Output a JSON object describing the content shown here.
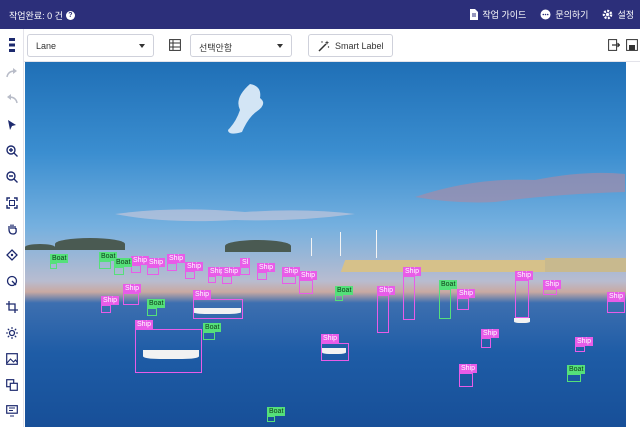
{
  "header": {
    "status_label": "작업완료: 0 건",
    "guide_label": "작업 가이드",
    "contact_label": "문의하기",
    "settings_label": "설정"
  },
  "toolbar": {
    "mode_select": "Lane",
    "region_select": "선택안함",
    "smart_label": "Smart Label"
  },
  "sidebar": {
    "tools": [
      "menu-icon",
      "redo-icon",
      "undo-icon",
      "pointer-icon",
      "zoom-in-icon",
      "zoom-out-icon",
      "fit-icon",
      "pan-icon",
      "polygon-icon",
      "brush-icon",
      "crop-icon",
      "brightness-icon",
      "image-icon",
      "layers-icon",
      "comment-icon"
    ]
  },
  "colors": {
    "header_bg": "#2c2f7a",
    "ship_label": "#e85ce8",
    "boat_label": "#55e07a"
  },
  "annotations": [
    {
      "label": "Boat",
      "cls": "boat"
    },
    {
      "label": "Ship",
      "cls": "ship"
    },
    {
      "label": "Ship",
      "cls": "ship"
    },
    {
      "label": "Ship",
      "cls": "ship"
    },
    {
      "label": "Ship",
      "cls": "ship"
    },
    {
      "label": "Ship",
      "cls": "ship"
    },
    {
      "label": "Ship",
      "cls": "ship"
    },
    {
      "label": "Ship",
      "cls": "ship"
    },
    {
      "label": "Ship",
      "cls": "ship"
    },
    {
      "label": "Sl",
      "cls": "ship"
    },
    {
      "label": "Ship",
      "cls": "ship"
    },
    {
      "label": "Ship",
      "cls": "ship"
    },
    {
      "label": "Ship",
      "cls": "ship"
    },
    {
      "label": "Ship",
      "cls": "ship"
    },
    {
      "label": "Ship",
      "cls": "ship"
    },
    {
      "label": "Boat",
      "cls": "boat"
    },
    {
      "label": "Ship",
      "cls": "ship"
    },
    {
      "label": "Boat",
      "cls": "boat"
    },
    {
      "label": "Ship",
      "cls": "ship"
    },
    {
      "label": "Boat",
      "cls": "boat"
    },
    {
      "label": "Ship",
      "cls": "ship"
    },
    {
      "label": "Ship",
      "cls": "ship"
    },
    {
      "label": "Boat",
      "cls": "boat"
    },
    {
      "label": "Ship",
      "cls": "ship"
    },
    {
      "label": "Ship",
      "cls": "ship"
    },
    {
      "label": "Ship",
      "cls": "ship"
    },
    {
      "label": "Ship",
      "cls": "ship"
    },
    {
      "label": "Ship",
      "cls": "ship"
    },
    {
      "label": "Ship",
      "cls": "ship"
    },
    {
      "label": "Ship",
      "cls": "ship"
    },
    {
      "label": "Ship",
      "cls": "ship"
    },
    {
      "label": "Boat",
      "cls": "boat"
    },
    {
      "label": "Boat",
      "cls": "boat"
    },
    {
      "label": "Boat",
      "cls": "boat"
    },
    {
      "label": "Boat",
      "cls": "boat"
    },
    {
      "label": "Boat",
      "cls": "boat"
    }
  ]
}
